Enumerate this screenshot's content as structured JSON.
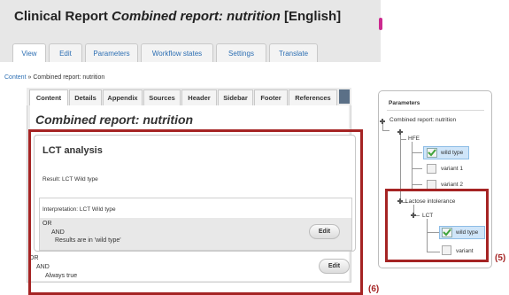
{
  "header": {
    "title_prefix": "Clinical Report",
    "title_italic": "Combined report: nutrition",
    "title_suffix": "[English]",
    "tabs": [
      "View",
      "Edit",
      "Parameters",
      "Workflow states",
      "Settings",
      "Translate"
    ]
  },
  "breadcrumb": {
    "link": "Content",
    "separator": "»",
    "current": "Combined report: nutrition"
  },
  "content_panel": {
    "tabs": [
      "Content",
      "Details",
      "Appendix",
      "Sources",
      "Header",
      "Sidebar",
      "Footer",
      "References"
    ],
    "title": "Combined report: nutrition",
    "section": {
      "title": "LCT analysis",
      "result": "Result: LCT Wild type",
      "interpretation": "Interpretation: LCT Wild type",
      "or_label": "OR",
      "and_label": "AND",
      "condition_text": "Results are in 'wild type'",
      "edit_label": "Edit"
    },
    "outer": {
      "or_label": "OR",
      "and_label": "AND",
      "condition_text": "Always true",
      "edit_label": "Edit"
    },
    "annotation_label": "(6)"
  },
  "parameters": {
    "title": "Parameters",
    "root": "Combined report: nutrition",
    "hfe": {
      "label": "HFE",
      "items": [
        "wild type",
        "variant 1",
        "variant 2"
      ]
    },
    "lactose": {
      "label": "Lactose intolerance",
      "lct": {
        "label": "LCT",
        "items": [
          "wild type",
          "variant"
        ]
      }
    },
    "annotation_label": "(5)"
  },
  "colors": {
    "highlight_red": "#a52424",
    "link_blue": "#2d6fb3",
    "selection_blue": "#cfe5f9",
    "check_green": "#4caf50"
  }
}
